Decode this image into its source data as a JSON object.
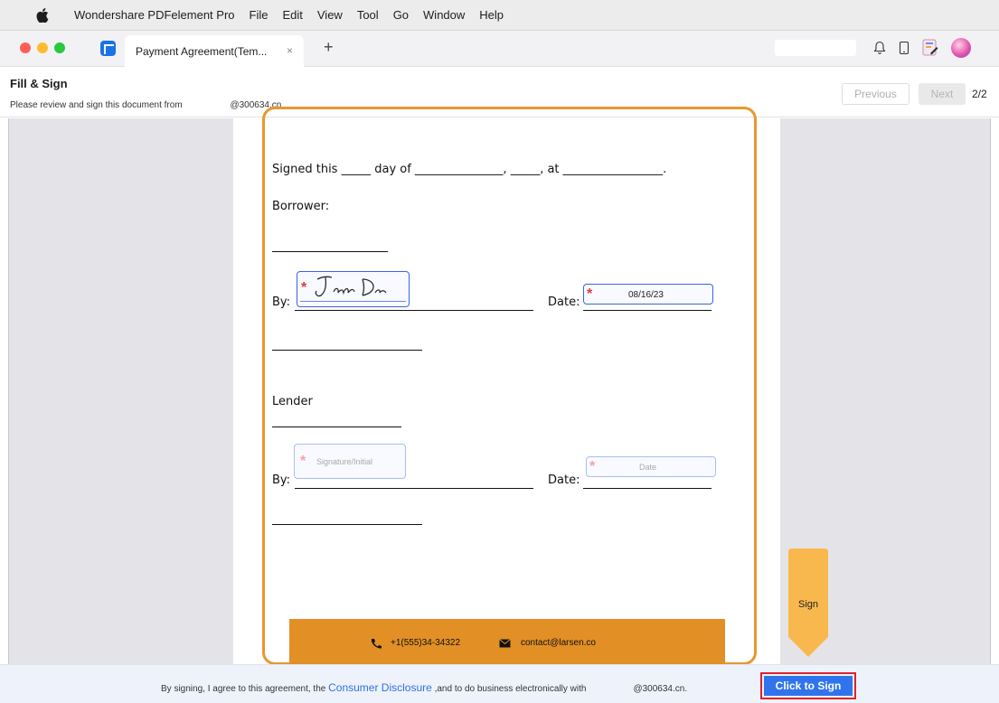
{
  "menubar": {
    "app_name": "Wondershare PDFelement Pro",
    "items": [
      "File",
      "Edit",
      "View",
      "Tool",
      "Go",
      "Window",
      "Help"
    ]
  },
  "tabbar": {
    "doc_tab_title": "Payment Agreement(Tem...",
    "close_symbol": "×",
    "new_tab_symbol": "+",
    "icons": [
      "bell-icon",
      "tablet-icon",
      "form-icon",
      "avatar"
    ]
  },
  "header": {
    "title": "Fill & Sign",
    "subtitle": "Please review and sign this document from",
    "sender_email": "@300634.cn",
    "previous_label": "Previous",
    "next_label": "Next",
    "page_indicator": "2/2"
  },
  "document": {
    "signed_line": "Signed this _____ day of _______________, _____, at _________________.",
    "borrower_label": "Borrower:",
    "by_label": "By:",
    "date_label": "Date:",
    "lender_label": "Lender",
    "borrower_signature": "Jane Doe",
    "borrower_date": "08/16/23",
    "lender_signature_placeholder": "Signature/Initial",
    "lender_date_placeholder": "Date",
    "required_mark": "*",
    "footer_phone": "+1(555)34-34322",
    "footer_email": "contact@larsen.co"
  },
  "sign_flag": {
    "label": "Sign"
  },
  "bottom_bar": {
    "agree_prefix": "By signing, I agree to this agreement, the ",
    "consumer_disclosure": "Consumer Disclosure",
    "agree_suffix": " ,and to do business electronically with",
    "sender_email": "@300634.cn.",
    "sign_button": "Click to Sign"
  },
  "colors": {
    "accent_orange": "#e8982f",
    "footer_orange": "#e28f25",
    "sign_blue": "#2f74ec",
    "highlight_red": "#e0202c"
  }
}
